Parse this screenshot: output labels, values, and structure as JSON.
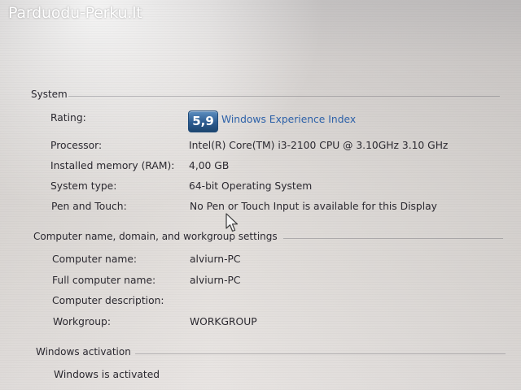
{
  "watermark": "Parduodu-Perku.lt",
  "system": {
    "title": "System",
    "rating_label": "Rating:",
    "rating_score": "5,9",
    "rating_link": "Windows Experience Index",
    "processor_label": "Processor:",
    "processor_value": "Intel(R) Core(TM) i3-2100 CPU @ 3.10GHz   3.10 GHz",
    "memory_label": "Installed memory (RAM):",
    "memory_value": "4,00 GB",
    "type_label": "System type:",
    "type_value": "64-bit Operating System",
    "pen_label": "Pen and Touch:",
    "pen_value": "No Pen or Touch Input is available for this Display"
  },
  "computer": {
    "title": "Computer name, domain, and workgroup settings",
    "name_label": "Computer name:",
    "name_value": "alviurn-PC",
    "full_label": "Full computer name:",
    "full_value": "alviurn-PC",
    "desc_label": "Computer description:",
    "desc_value": "",
    "workgroup_label": "Workgroup:",
    "workgroup_value": "WORKGROUP"
  },
  "activation": {
    "title": "Windows activation",
    "status": "Windows is activated"
  },
  "colors": {
    "link": "#2d61a8",
    "badge": "#2c5b90",
    "text": "#2b2930"
  },
  "icons": {
    "cursor": "mouse-pointer-icon"
  }
}
